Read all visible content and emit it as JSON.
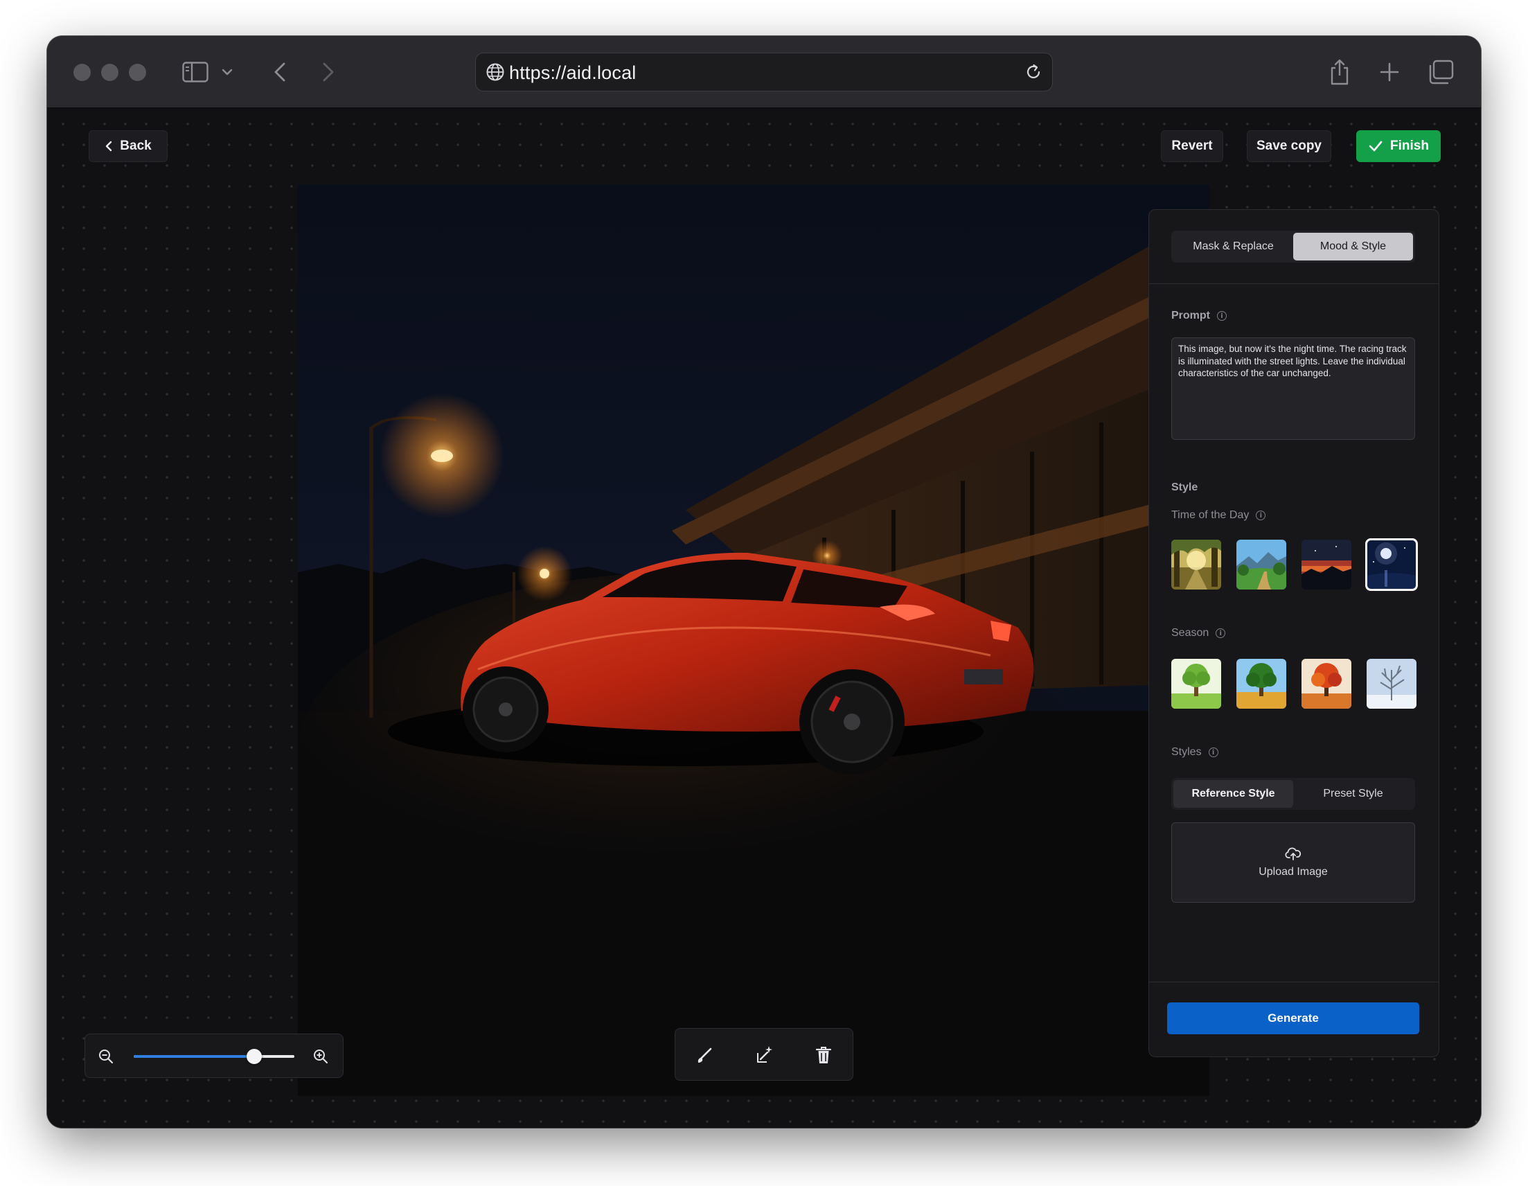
{
  "browser": {
    "url": "https://aid.local"
  },
  "header": {
    "back_label": "Back",
    "revert_label": "Revert",
    "save_copy_label": "Save copy",
    "finish_label": "Finish"
  },
  "panel": {
    "tabs": [
      {
        "label": "Mask & Replace",
        "active": false
      },
      {
        "label": "Mood & Style",
        "active": true
      }
    ],
    "prompt_label": "Prompt",
    "prompt_text": "This image, but now it's the night time. The racing track is illuminated with the street lights. Leave the individual characteristics of the car unchanged.",
    "style_heading": "Style",
    "time_of_day_label": "Time of the Day",
    "time_of_day_options": [
      "sunrise-forest",
      "daytime-valley",
      "sunset",
      "night-moon"
    ],
    "time_of_day_selected": "night-moon",
    "season_label": "Season",
    "season_options": [
      "spring-tree",
      "summer-tree",
      "autumn-tree",
      "winter-tree"
    ],
    "styles_label": "Styles",
    "style_tabs": [
      {
        "label": "Reference Style",
        "active": true
      },
      {
        "label": "Preset Style",
        "active": false
      }
    ],
    "upload_label": "Upload Image",
    "generate_label": "Generate"
  },
  "zoom": {
    "level_fraction": 0.75
  },
  "colors": {
    "accent_green": "#14a049",
    "accent_blue": "#0a62c9",
    "window_bg": "#111113"
  },
  "icons": [
    "sidebar-icon",
    "chevron-down-icon",
    "back-arrow-icon",
    "forward-arrow-icon",
    "globe-icon",
    "reload-icon",
    "share-icon",
    "new-tab-icon",
    "tabs-overview-icon",
    "chevron-left-icon",
    "checkmark-icon",
    "info-icon",
    "upload-cloud-icon",
    "zoom-out-icon",
    "zoom-in-icon",
    "brush-icon",
    "magic-wand-icon",
    "trash-icon"
  ]
}
